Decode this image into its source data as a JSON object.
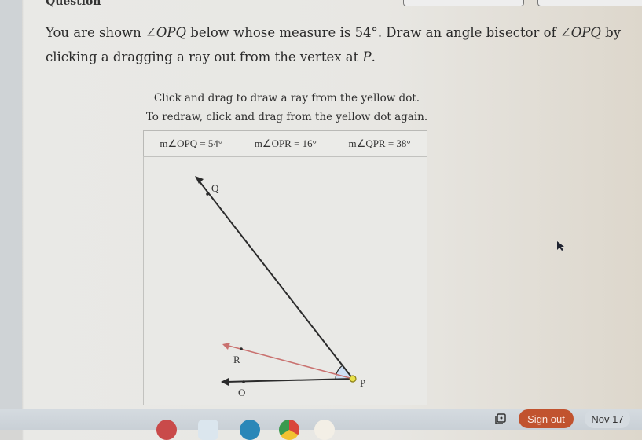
{
  "header": {
    "fragment_label": "Question"
  },
  "question": {
    "text_1": "You are shown ",
    "angle_1": "∠OPQ",
    "text_2": " below whose measure is ",
    "measure": "54°",
    "text_3": ". Draw an angle bisector of ",
    "angle_2": "∠OPQ",
    "text_4": " by clicking a dragging a ray out from the vertex at ",
    "vertex": "P",
    "text_5": "."
  },
  "instructions": {
    "line_1": "Click and drag to draw a ray from the yellow dot.",
    "line_2": "To redraw, click and drag from the yellow dot again."
  },
  "measures": [
    {
      "label": "m∠OPQ = 54°"
    },
    {
      "label": "m∠OPR = 16°"
    },
    {
      "label": "m∠QPR = 38°"
    }
  ],
  "diagram": {
    "points": {
      "Q": "Q",
      "R": "R",
      "O": "O",
      "P": "P"
    },
    "colors": {
      "ray": "#2b2b2b",
      "drawn_ray": "#c9716f",
      "vertex_dot": "#e8e04a",
      "angle_fill": "#cfe0f4"
    }
  },
  "taskbar": {
    "sign_out": "Sign out",
    "date": "Nov 17",
    "apps": [
      "app-1",
      "app-2",
      "app-3",
      "chrome",
      "app-5"
    ]
  }
}
